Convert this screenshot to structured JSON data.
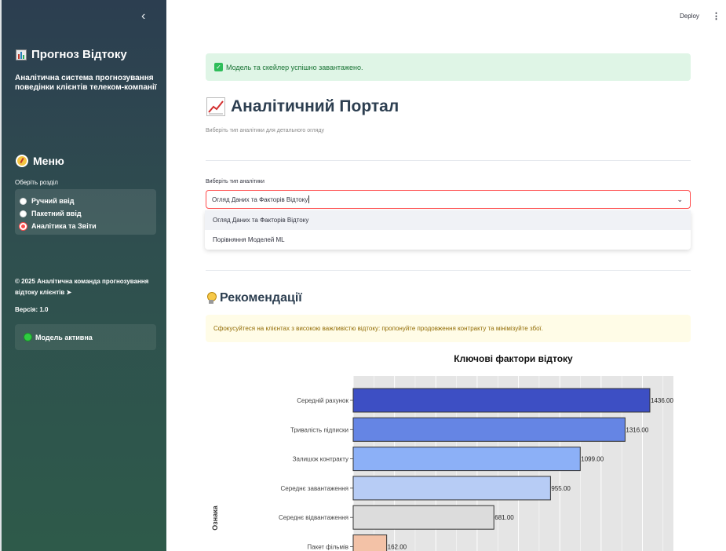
{
  "sidebar": {
    "collapse_icon": "chevron-left-icon",
    "brand": "Прогноз Відтоку",
    "subtitle": "Аналітична система прогнозування поведінки клієнтів телеком-компанії",
    "menu_title": "Меню",
    "section_label": "Оберіть розділ",
    "radio_items": [
      {
        "label": "Ручний ввід",
        "selected": false
      },
      {
        "label": "Пакетний ввід",
        "selected": false
      },
      {
        "label": "Аналітика та Звіти",
        "selected": true
      }
    ],
    "copyright": "© 2025 Аналітична команда прогнозування відтоку клієнтів",
    "version": "Версія: 1.0",
    "model_status": "Модель активна"
  },
  "topbar": {
    "deploy": "Deploy",
    "menu_icon": "more-vertical-icon"
  },
  "main": {
    "success_message": "Модель та скейлер успішно завантажено.",
    "title": "Аналітичний Портал",
    "subtitle": "Виберіть тип аналітики для детального огляду",
    "select_label": "Виберіть тип аналітики",
    "select_value": "Огляд Даних та Факторів Відтоку",
    "options": [
      "Огляд Даних та Факторів Відтоку",
      "Порівняння Моделей ML"
    ],
    "recommendations_title": "Рекомендації",
    "recommendation_text": "Сфокусуйтеся на клієнтах з високою важливістю відтоку: пропонуйте продовження контракту та мінімізуйте збої."
  },
  "colors": {
    "accent": "#ff4b4b",
    "success_bg": "#dff5e6",
    "warning_bg": "#fffce7"
  },
  "chart_data": {
    "type": "bar",
    "orientation": "horizontal",
    "title": "Ключові фактори відтоку",
    "ylabel": "Ознака",
    "categories": [
      "Середній рахунок",
      "Тривалість підписки",
      "Залишок контракту",
      "Середнє завантаження",
      "Середнє відвантаження",
      "Пакет фільмів"
    ],
    "values": [
      1436.0,
      1316.0,
      1099.0,
      955.0,
      681.0,
      162.0
    ],
    "value_labels": [
      "1436.00",
      "1316.00",
      "1099.00",
      "955.00",
      "681.00",
      "162.00"
    ],
    "bar_colors": [
      "#3d4fc4",
      "#6585e4",
      "#8cb0f7",
      "#b7ccf5",
      "#dcdcdc",
      "#f3c2a7"
    ],
    "xlim": [
      0,
      1550
    ],
    "grid": true
  }
}
